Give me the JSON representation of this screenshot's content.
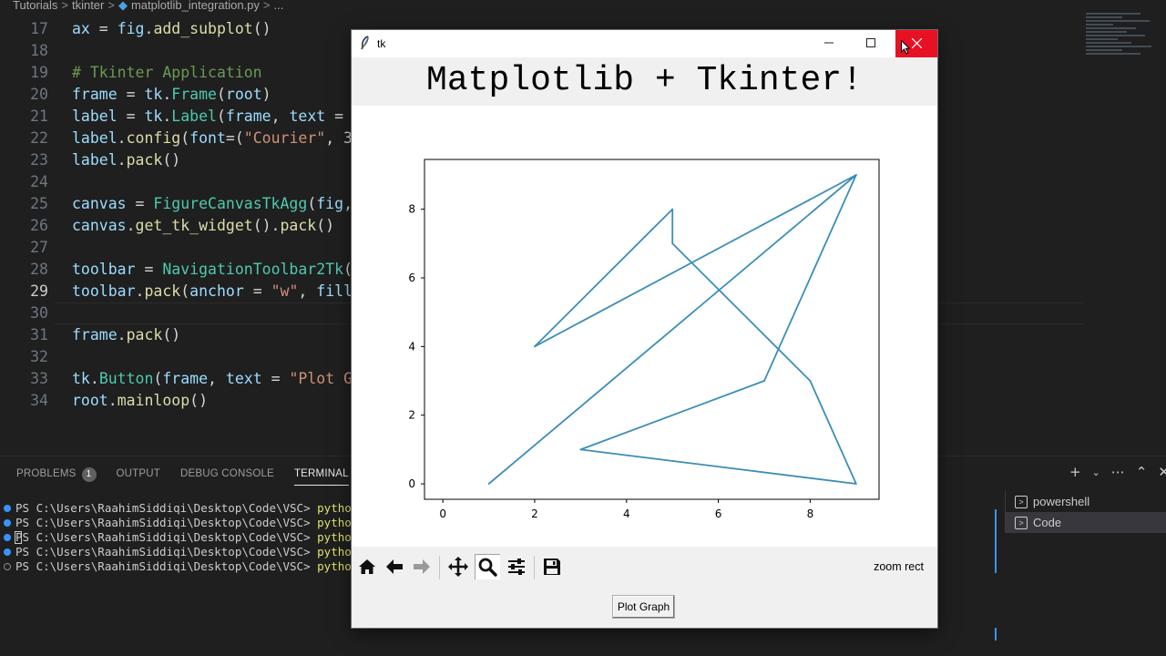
{
  "editor": {
    "breadcrumb": [
      "Tutorials",
      "tkinter",
      "matplotlib_integration.py",
      "..."
    ],
    "lines": [
      {
        "num": "17",
        "tokens": [
          [
            "var",
            "ax"
          ],
          [
            "op",
            " = "
          ],
          [
            "var",
            "fig"
          ],
          [
            "op",
            "."
          ],
          [
            "fn",
            "add_subplot"
          ],
          [
            "op",
            "()"
          ]
        ]
      },
      {
        "num": "18",
        "tokens": []
      },
      {
        "num": "19",
        "tokens": [
          [
            "cm",
            "# Tkinter Application"
          ]
        ]
      },
      {
        "num": "20",
        "tokens": [
          [
            "var",
            "frame"
          ],
          [
            "op",
            " = "
          ],
          [
            "var",
            "tk"
          ],
          [
            "op",
            "."
          ],
          [
            "cls",
            "Frame"
          ],
          [
            "op",
            "("
          ],
          [
            "var",
            "root"
          ],
          [
            "op",
            ")"
          ]
        ]
      },
      {
        "num": "21",
        "tokens": [
          [
            "var",
            "label"
          ],
          [
            "op",
            " = "
          ],
          [
            "var",
            "tk"
          ],
          [
            "op",
            "."
          ],
          [
            "cls",
            "Label"
          ],
          [
            "op",
            "("
          ],
          [
            "var",
            "frame"
          ],
          [
            "op",
            ", "
          ],
          [
            "var",
            "text"
          ],
          [
            "op",
            " = "
          ]
        ]
      },
      {
        "num": "22",
        "tokens": [
          [
            "var",
            "label"
          ],
          [
            "op",
            "."
          ],
          [
            "fn",
            "config"
          ],
          [
            "op",
            "("
          ],
          [
            "var",
            "font"
          ],
          [
            "op",
            "=("
          ],
          [
            "str",
            "\"Courier\""
          ],
          [
            "op",
            ", 3"
          ]
        ]
      },
      {
        "num": "23",
        "tokens": [
          [
            "var",
            "label"
          ],
          [
            "op",
            "."
          ],
          [
            "fn",
            "pack"
          ],
          [
            "op",
            "()"
          ]
        ]
      },
      {
        "num": "24",
        "tokens": []
      },
      {
        "num": "25",
        "tokens": [
          [
            "var",
            "canvas"
          ],
          [
            "op",
            " = "
          ],
          [
            "cls",
            "FigureCanvasTkAgg"
          ],
          [
            "op",
            "("
          ],
          [
            "var",
            "fig"
          ],
          [
            "op",
            ","
          ]
        ]
      },
      {
        "num": "26",
        "tokens": [
          [
            "var",
            "canvas"
          ],
          [
            "op",
            "."
          ],
          [
            "fn",
            "get_tk_widget"
          ],
          [
            "op",
            "()."
          ],
          [
            "fn",
            "pack"
          ],
          [
            "op",
            "()"
          ]
        ]
      },
      {
        "num": "27",
        "tokens": []
      },
      {
        "num": "28",
        "tokens": [
          [
            "var",
            "toolbar"
          ],
          [
            "op",
            " = "
          ],
          [
            "cls",
            "NavigationToolbar2Tk"
          ],
          [
            "op",
            "("
          ]
        ]
      },
      {
        "num": "29",
        "tokens": [
          [
            "var",
            "toolbar"
          ],
          [
            "op",
            "."
          ],
          [
            "fn",
            "pack"
          ],
          [
            "op",
            "("
          ],
          [
            "var",
            "anchor"
          ],
          [
            "op",
            " = "
          ],
          [
            "str",
            "\"w\""
          ],
          [
            "op",
            ", "
          ],
          [
            "var",
            "fill"
          ]
        ]
      },
      {
        "num": "30",
        "tokens": []
      },
      {
        "num": "31",
        "tokens": [
          [
            "var",
            "frame"
          ],
          [
            "op",
            "."
          ],
          [
            "fn",
            "pack"
          ],
          [
            "op",
            "()"
          ]
        ]
      },
      {
        "num": "32",
        "tokens": []
      },
      {
        "num": "33",
        "tokens": [
          [
            "var",
            "tk"
          ],
          [
            "op",
            "."
          ],
          [
            "cls",
            "Button"
          ],
          [
            "op",
            "("
          ],
          [
            "var",
            "frame"
          ],
          [
            "op",
            ", "
          ],
          [
            "var",
            "text"
          ],
          [
            "op",
            " = "
          ],
          [
            "str",
            "\"Plot G"
          ]
        ]
      },
      {
        "num": "34",
        "tokens": [
          [
            "var",
            "root"
          ],
          [
            "op",
            "."
          ],
          [
            "fn",
            "mainloop"
          ],
          [
            "op",
            "()"
          ]
        ]
      }
    ],
    "active_line": "29"
  },
  "panel": {
    "tabs": [
      {
        "label": "PROBLEMS",
        "badge": "1",
        "active": false
      },
      {
        "label": "OUTPUT",
        "active": false
      },
      {
        "label": "DEBUG CONSOLE",
        "active": false
      },
      {
        "label": "TERMINAL",
        "active": true
      }
    ],
    "actions": [
      "+",
      "⌄",
      "⋯",
      "⌃",
      "✕"
    ],
    "terminal_lines": [
      {
        "prompt": "PS C:\\Users\\RaahimSiddiqi\\Desktop\\Code\\VSC> ",
        "cmd": "python",
        "dot": "filled"
      },
      {
        "prompt": "PS C:\\Users\\RaahimSiddiqi\\Desktop\\Code\\VSC> ",
        "cmd": "python",
        "dot": "filled"
      },
      {
        "prompt": "PS C:\\Users\\RaahimSiddiqi\\Desktop\\Code\\VSC> ",
        "cmd": "python",
        "dot": "filled"
      },
      {
        "prompt": "PS C:\\Users\\RaahimSiddiqi\\Desktop\\Code\\VSC> ",
        "cmd": "python",
        "dot": "filled"
      },
      {
        "prompt": "PS C:\\Users\\RaahimSiddiqi\\Desktop\\Code\\VSC> ",
        "cmd": "python",
        "dot": "hollow"
      }
    ],
    "terminals": [
      {
        "label": "powershell",
        "active": false
      },
      {
        "label": "Code",
        "active": true
      }
    ]
  },
  "tk_window": {
    "title": "tk",
    "heading": "Matplotlib + Tkinter!",
    "toolbar_message": "zoom rect",
    "plot_button_label": "Plot Graph",
    "tools": [
      "home-icon",
      "back-arrow-icon",
      "forward-arrow-icon",
      "pan-icon",
      "zoom-icon",
      "subplots-icon",
      "save-icon"
    ],
    "pressed_tool": "zoom-icon"
  },
  "chart_data": {
    "type": "line",
    "x": [
      1,
      9,
      2,
      5,
      5,
      8,
      9,
      3,
      7,
      9
    ],
    "y": [
      0,
      9,
      4,
      8,
      7,
      3,
      0,
      1,
      3,
      9
    ],
    "xlim": [
      -0.4,
      9.5
    ],
    "ylim": [
      -0.45,
      9.45
    ],
    "xticks": [
      "0",
      "2",
      "4",
      "6",
      "8"
    ],
    "yticks": [
      "0",
      "2",
      "4",
      "6",
      "8"
    ],
    "line_color": "#3b8eb8",
    "title": "",
    "xlabel": "",
    "ylabel": "",
    "grid": false
  }
}
